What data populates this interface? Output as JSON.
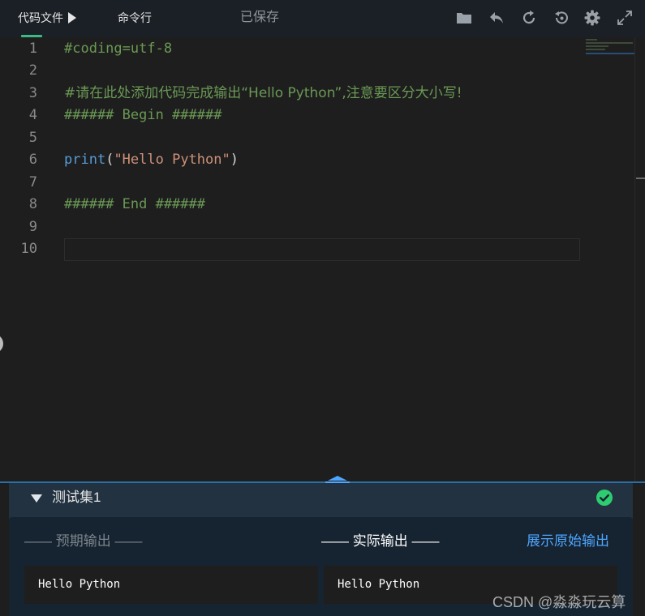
{
  "toolbar": {
    "tabs": [
      {
        "label": "代码文件"
      },
      {
        "label": "命令行"
      }
    ],
    "status": "已保存",
    "icons": [
      "folder-icon",
      "undo-icon",
      "refresh-icon",
      "restore-icon",
      "gear-icon",
      "fullscreen-icon"
    ]
  },
  "editor": {
    "line_numbers": [
      "1",
      "2",
      "3",
      "4",
      "5",
      "6",
      "7",
      "8",
      "9",
      "10"
    ],
    "lines": {
      "l1": "#coding=utf-8",
      "l3": "#请在此处添加代码完成输出“Hello Python”,注意要区分大小写!",
      "l4": "###### Begin ######",
      "l6_fn": "print",
      "l6_open": "(",
      "l6_str": "\"Hello Python\"",
      "l6_close": ")",
      "l8": "###### End ######"
    },
    "colors": {
      "comment": "#6a9955",
      "function": "#569cd6",
      "string": "#ce9178"
    }
  },
  "testset": {
    "title": "测试集1",
    "status": "passed",
    "expected_label": "—— 预期输出 ——",
    "actual_label": "—— 实际输出 ——",
    "raw_link": "展示原始输出",
    "expected_output": "Hello Python",
    "actual_output": "Hello Python"
  },
  "watermark": "CSDN @淼淼玩云算",
  "accent": {
    "tab_underline": "#3fb984",
    "link": "#4ea6ff",
    "success": "#2ecc71"
  }
}
